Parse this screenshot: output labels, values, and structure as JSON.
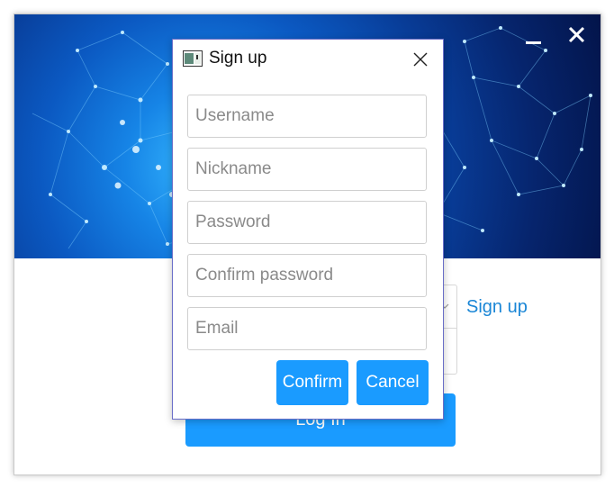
{
  "window": {
    "minimize_icon": "minimize-icon",
    "close_icon": "close-icon"
  },
  "login": {
    "signup_link": "Sign up",
    "login_button": "Log In"
  },
  "dialog": {
    "title": "Sign up",
    "app_icon": "window-app-icon",
    "close_icon": "close-icon",
    "fields": {
      "username": {
        "placeholder": "Username",
        "value": ""
      },
      "nickname": {
        "placeholder": "Nickname",
        "value": ""
      },
      "password": {
        "placeholder": "Password",
        "value": ""
      },
      "confirm_password": {
        "placeholder": "Confirm password",
        "value": ""
      },
      "email": {
        "placeholder": "Email",
        "value": ""
      }
    },
    "confirm_label": "Confirm",
    "cancel_label": "Cancel"
  },
  "colors": {
    "accent": "#1a9bff",
    "link": "#1a86d6",
    "dialog_border": "#6a6ec8"
  }
}
